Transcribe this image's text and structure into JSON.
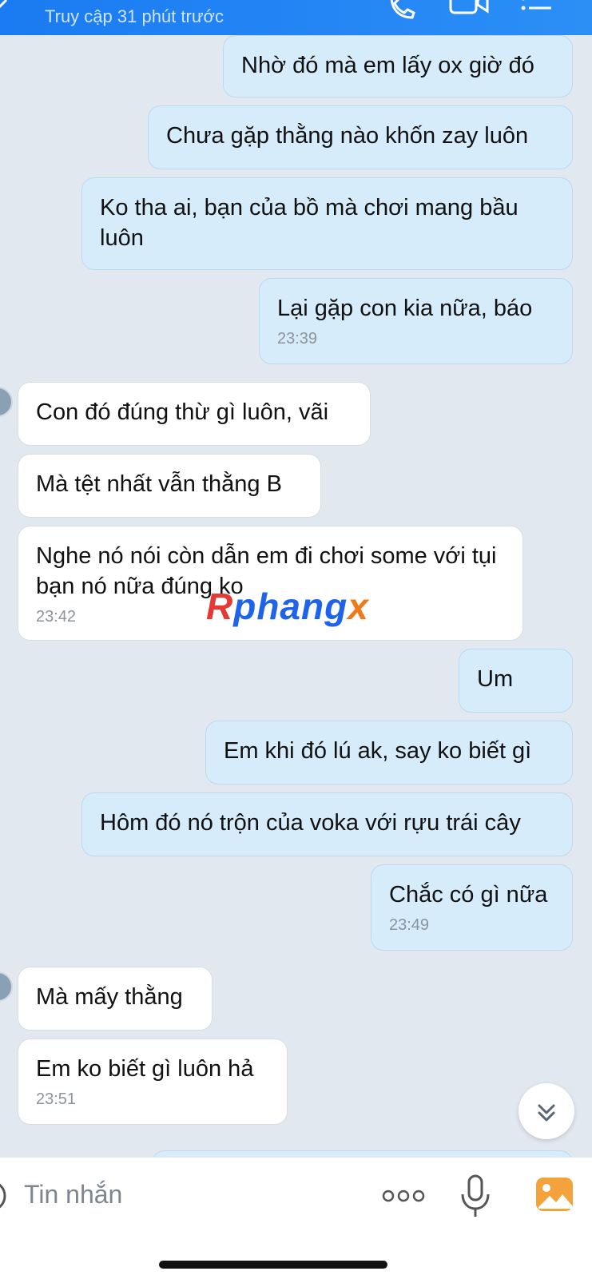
{
  "header": {
    "status": "Truy cập 31 phút trước"
  },
  "messages": [
    {
      "side": "out",
      "text": "Nhờ đó mà em lấy ox giờ đó"
    },
    {
      "side": "out",
      "text": "Chưa gặp thằng nào khốn zay luôn"
    },
    {
      "side": "out",
      "text": "Ko tha ai, bạn của bồ mà chơi mang bầu luôn"
    },
    {
      "side": "out",
      "text": "Lại gặp con kia nữa, báo",
      "time": "23:39"
    },
    {
      "side": "in",
      "text": "Con đó đúng thừ gì luôn, vãi"
    },
    {
      "side": "in",
      "text": "Mà tệt nhất vẫn thằng B"
    },
    {
      "side": "in",
      "text": "Nghe nó nói còn dẫn em đi chơi some với tụi bạn nó nữa đúng ko",
      "time": "23:42"
    },
    {
      "side": "out",
      "text": "Um"
    },
    {
      "side": "out",
      "text": "Em khi đó lú ak, say ko biết gì"
    },
    {
      "side": "out",
      "text": "Hôm đó nó trộn của voka với rựu trái cây"
    },
    {
      "side": "out",
      "text": "Chắc có gì nữa",
      "time": "23:49"
    },
    {
      "side": "in",
      "text": "Mà mấy thằng"
    },
    {
      "side": "in",
      "text": "Em ko biết gì luôn hả",
      "time": "23:51"
    }
  ],
  "watermark": {
    "part1": "R",
    "part2": "phang",
    "part3": "x"
  },
  "composer": {
    "placeholder": "Tin nhắn"
  },
  "colors": {
    "header": "#1a7bf2",
    "outgoing_bubble": "#d6ecfb",
    "incoming_bubble": "#ffffff",
    "background": "#e2e8f0"
  },
  "icons": [
    "back-icon",
    "phone-icon",
    "video-call-icon",
    "menu-icon",
    "scroll-down-icon",
    "emoji-icon",
    "more-icon",
    "microphone-icon",
    "image-icon"
  ]
}
